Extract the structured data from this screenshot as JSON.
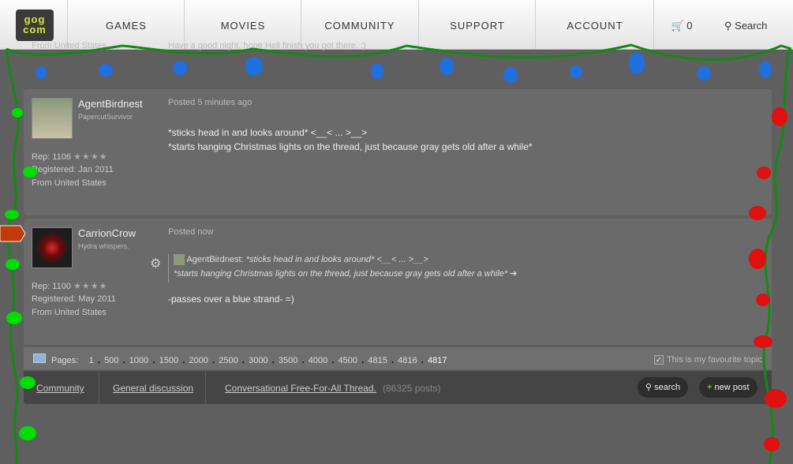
{
  "header": {
    "logo_top": "gog",
    "logo_bottom": "com",
    "nav": [
      "GAMES",
      "MOVIES",
      "COMMUNITY",
      "SUPPORT",
      "ACCOUNT"
    ],
    "cart_count": "0",
    "search_label": "Search"
  },
  "overlap": {
    "left_text": "From United States",
    "right_text": "Have a good night, hope Hell finish you got there. :)"
  },
  "posts": [
    {
      "username": "AgentBirdnest",
      "user_title": "PapercutSurvivor",
      "posted": "Posted 5 minutes ago",
      "rep": "Rep: 1106",
      "stars": "★★★★",
      "registered": "Registered: Jan 2011",
      "from": "From United States",
      "lines": [
        "*sticks head in and looks around* <__< ... >__>",
        "*starts hanging Christmas lights on the thread, just because gray gets old after a while*"
      ]
    },
    {
      "username": "CarrionCrow",
      "user_title": "Hydra whispers.",
      "posted": "Posted now",
      "rep": "Rep: 1100",
      "stars": "★★★★",
      "registered": "Registered: May 2011",
      "from": "From United States",
      "quote_author": "AgentBirdnest:",
      "quote_line1": "*sticks head in and looks around* <__< ... >__>",
      "quote_line2": "*starts hanging Christmas lights on the thread, just because gray gets old after a while*",
      "text": "-passes over a blue strand- =)"
    }
  ],
  "pagination": {
    "label": "Pages:",
    "pages": [
      "1",
      "500",
      "1000",
      "1500",
      "2000",
      "2500",
      "3000",
      "3500",
      "4000",
      "4500",
      "4815",
      "4816",
      "4817"
    ],
    "favourite": "This is my favourite topic"
  },
  "breadcrumb": {
    "community": "Community",
    "general": "General discussion",
    "thread": "Conversational Free-For-All Thread.",
    "post_count": "(86325 posts)"
  },
  "buttons": {
    "search": "search",
    "new_post": "new post"
  },
  "colors": {
    "blue_light": "#1e6fe0",
    "red_light": "#e01010",
    "green_light": "#00dd00",
    "wire": "#138a13"
  }
}
